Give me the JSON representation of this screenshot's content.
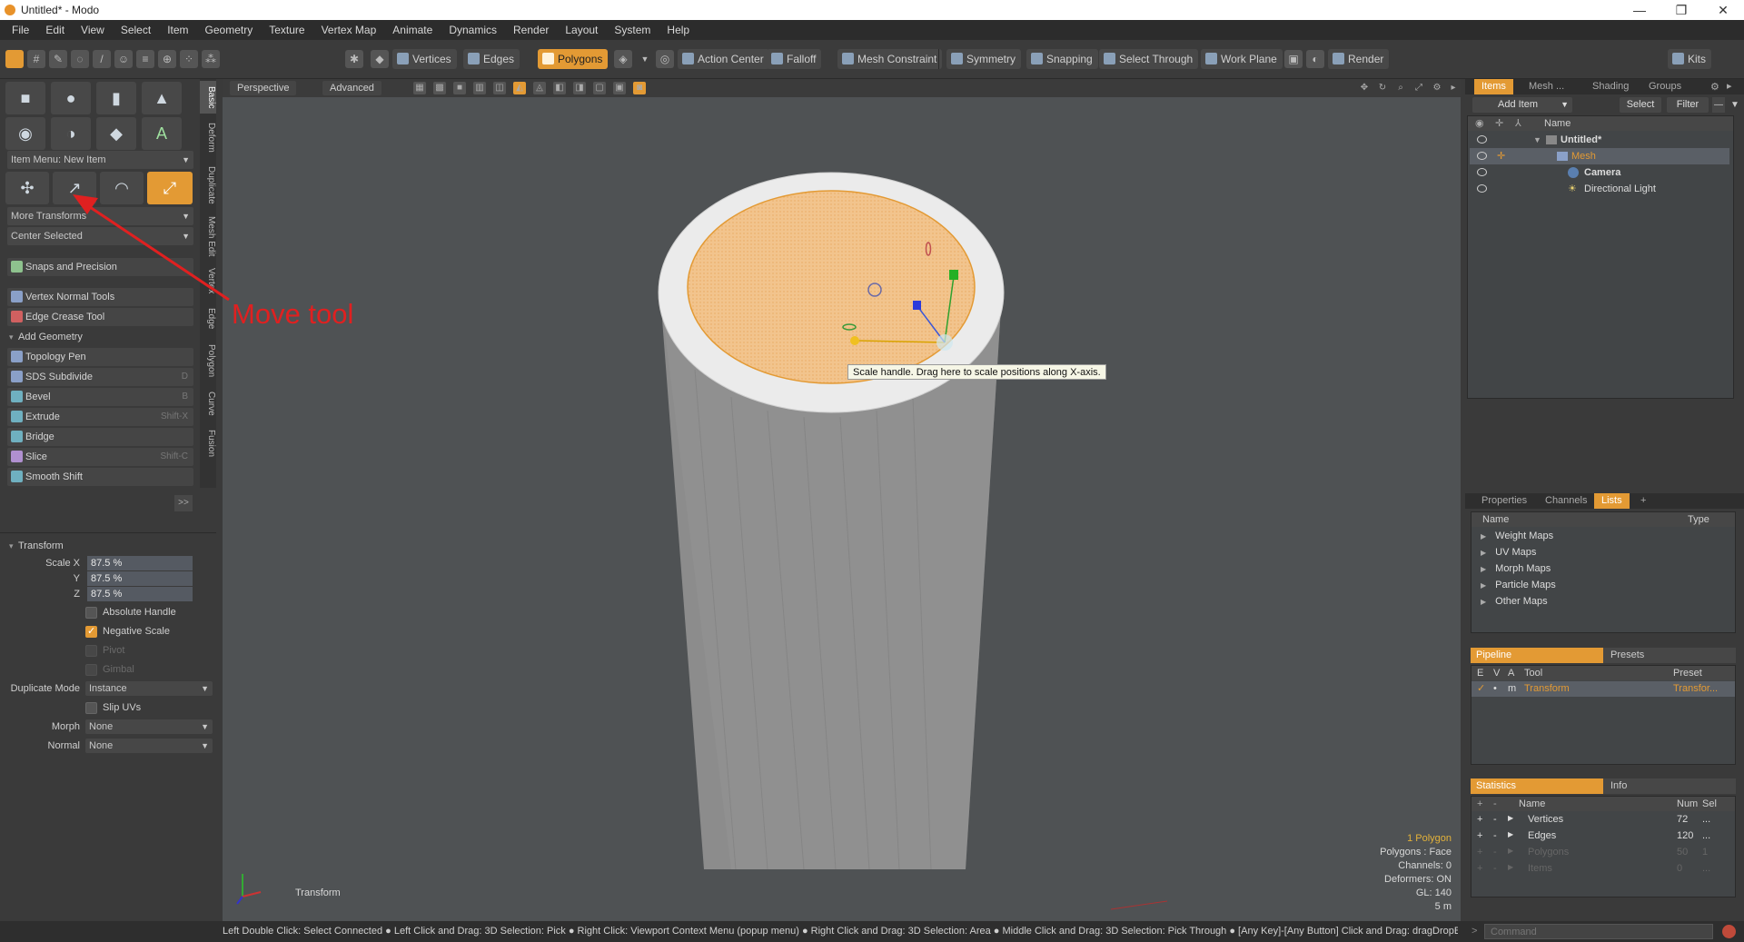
{
  "window": {
    "title": "Untitled* - Modo"
  },
  "menu": [
    "File",
    "Edit",
    "View",
    "Select",
    "Item",
    "Geometry",
    "Texture",
    "Vertex Map",
    "Animate",
    "Dynamics",
    "Render",
    "Layout",
    "System",
    "Help"
  ],
  "toolbar": {
    "vertices": "Vertices",
    "edges": "Edges",
    "polygons": "Polygons",
    "action_center": "Action Center",
    "falloff": "Falloff",
    "mesh_constraint": "Mesh Constraint",
    "symmetry": "Symmetry",
    "snapping": "Snapping",
    "select_through": "Select Through",
    "work_plane": "Work Plane",
    "render": "Render",
    "kits": "Kits"
  },
  "left": {
    "item_menu": "Item Menu: New Item",
    "more_transforms": "More Transforms",
    "center_selected": "Center Selected",
    "snaps": "Snaps and Precision",
    "vertex_normal": "Vertex Normal Tools",
    "edge_crease": "Edge Crease Tool",
    "add_geometry": "Add Geometry",
    "tools": [
      {
        "label": "Topology Pen",
        "shortcut": ""
      },
      {
        "label": "SDS Subdivide",
        "shortcut": "D"
      },
      {
        "label": "Bevel",
        "shortcut": "B"
      },
      {
        "label": "Extrude",
        "shortcut": "Shift-X"
      },
      {
        "label": "Bridge",
        "shortcut": ""
      },
      {
        "label": "Slice",
        "shortcut": "Shift-C"
      },
      {
        "label": "Smooth Shift",
        "shortcut": ""
      }
    ],
    "more": ">>",
    "vtabs": [
      "Basic",
      "Deform",
      "Duplicate",
      "Mesh Edit",
      "Vertex",
      "Edge",
      "Polygon",
      "Curve",
      "Fusion"
    ]
  },
  "transform": {
    "header": "Transform",
    "scale_x_label": "Scale X",
    "scale_y_label": "Y",
    "scale_z_label": "Z",
    "scale_x": "87.5 %",
    "scale_y": "87.5 %",
    "scale_z": "87.5 %",
    "absolute_handle": "Absolute Handle",
    "negative_scale": "Negative Scale",
    "pivot": "Pivot",
    "gimbal": "Gimbal",
    "duplicate_mode_label": "Duplicate Mode",
    "duplicate_mode": "Instance",
    "slip_uvs": "Slip UVs",
    "morph_label": "Morph",
    "morph": "None",
    "normal_label": "Normal",
    "normal": "None"
  },
  "viewport": {
    "tab_perspective": "Perspective",
    "tab_advanced": "Advanced",
    "tooltip": "Scale handle. Drag here to scale positions along X-axis.",
    "annotation": "Move tool",
    "axis_label": "Transform",
    "stats": [
      "1 Polygon",
      "Polygons : Face",
      "Channels: 0",
      "Deformers: ON",
      "GL: 140",
      "5 m"
    ]
  },
  "right": {
    "tabs": [
      "Items",
      "Mesh ...",
      "Shading",
      "Groups"
    ],
    "add_item": "Add Item",
    "select": "Select",
    "filter": "Filter",
    "name_header": "Name",
    "tree": [
      "Untitled*",
      "Mesh",
      "Camera",
      "Directional Light"
    ],
    "props_tabs": [
      "Properties",
      "Channels",
      "Lists",
      "+"
    ],
    "lists_name": "Name",
    "lists_type": "Type",
    "maps": [
      "Weight Maps",
      "UV Maps",
      "Morph Maps",
      "Particle Maps",
      "Other Maps"
    ],
    "pipeline_tab": "Pipeline",
    "presets_tab": "Presets",
    "pipeline_cols": [
      "E",
      "V",
      "A",
      "Tool",
      "Preset"
    ],
    "pipeline_row": {
      "a": "m",
      "tool": "Transform",
      "preset": "Transfor..."
    },
    "statistics_tab": "Statistics",
    "info_tab": "Info",
    "stat_cols": [
      "Name",
      "Num",
      "Sel"
    ],
    "stats": [
      {
        "name": "Vertices",
        "num": "72",
        "sel": "..."
      },
      {
        "name": "Edges",
        "num": "120",
        "sel": "..."
      },
      {
        "name": "Polygons",
        "num": "50",
        "sel": "1"
      },
      {
        "name": "Items",
        "num": "0",
        "sel": "..."
      }
    ],
    "command": "Command"
  },
  "status_text": "Left Double Click: Select Connected ● Left Click and Drag: 3D Selection: Pick ● Right Click: Viewport Context Menu (popup menu) ● Right Click and Drag: 3D Selection: Area ● Middle Click and Drag: 3D Selection: Pick Through ● [Any Key]-[Any Button] Click and Drag: dragDropB ...",
  "colors": {
    "accent": "#e39a34",
    "annotation": "#e02020",
    "polygon_fill": "#f2c48d"
  }
}
